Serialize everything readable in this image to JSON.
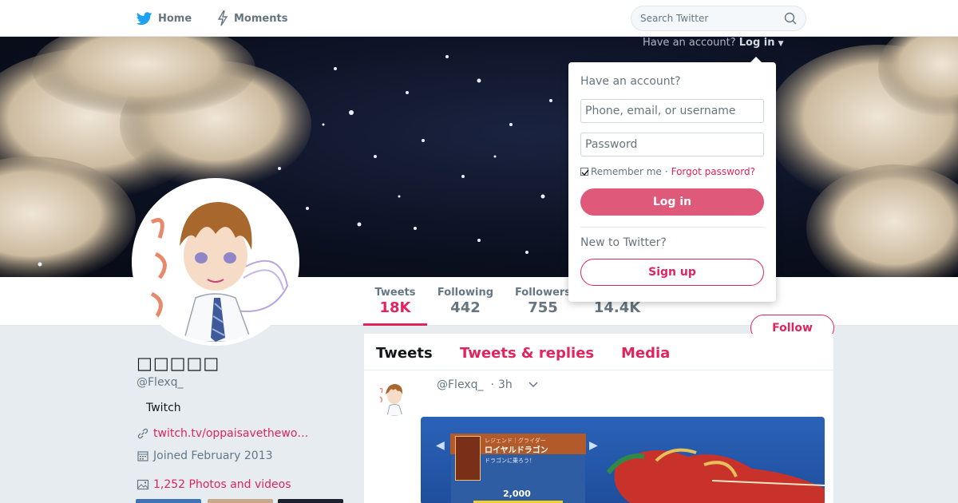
{
  "nav": {
    "home_label": "Home",
    "moments_label": "Moments",
    "search_placeholder": "Search Twitter"
  },
  "login_prompt": {
    "question": "Have an account?",
    "link": "Log in"
  },
  "profile": {
    "name": "□□□□□",
    "handle": "@Flexq_",
    "bio": "Twitch",
    "url": "twitch.tv/oppaisavethewo…",
    "joined": "Joined February 2013",
    "photos": "1,252 Photos and videos"
  },
  "stats": {
    "tweets_label": "Tweets",
    "tweets_value": "18K",
    "following_label": "Following",
    "following_value": "442",
    "followers_label": "Followers",
    "followers_value": "755",
    "likes_value": "14.4K"
  },
  "follow_label": "Follow",
  "timeline": {
    "tabs": [
      "Tweets",
      "Tweets & replies",
      "Media"
    ],
    "tweet": {
      "handle": "@Flexq_",
      "separator": "·",
      "time": "3h"
    },
    "media": {
      "item_subtitle": "レジェンド｜グライダー",
      "item_name": "ロイヤルドラゴン",
      "item_desc": "ドラゴンに乗ろう！",
      "price": "2,000"
    }
  },
  "dropdown": {
    "title": "Have an account?",
    "username_placeholder": "Phone, email, or username",
    "password_placeholder": "Password",
    "remember": "Remember me",
    "separator": "·",
    "forgot": "Forgot password?",
    "login_button": "Log in",
    "new_prompt": "New to Twitter?",
    "signup_button": "Sign up"
  },
  "colors": {
    "accent": "#e0245e",
    "login_button": "#df5a7a",
    "page_bg": "#e6ecf0"
  }
}
